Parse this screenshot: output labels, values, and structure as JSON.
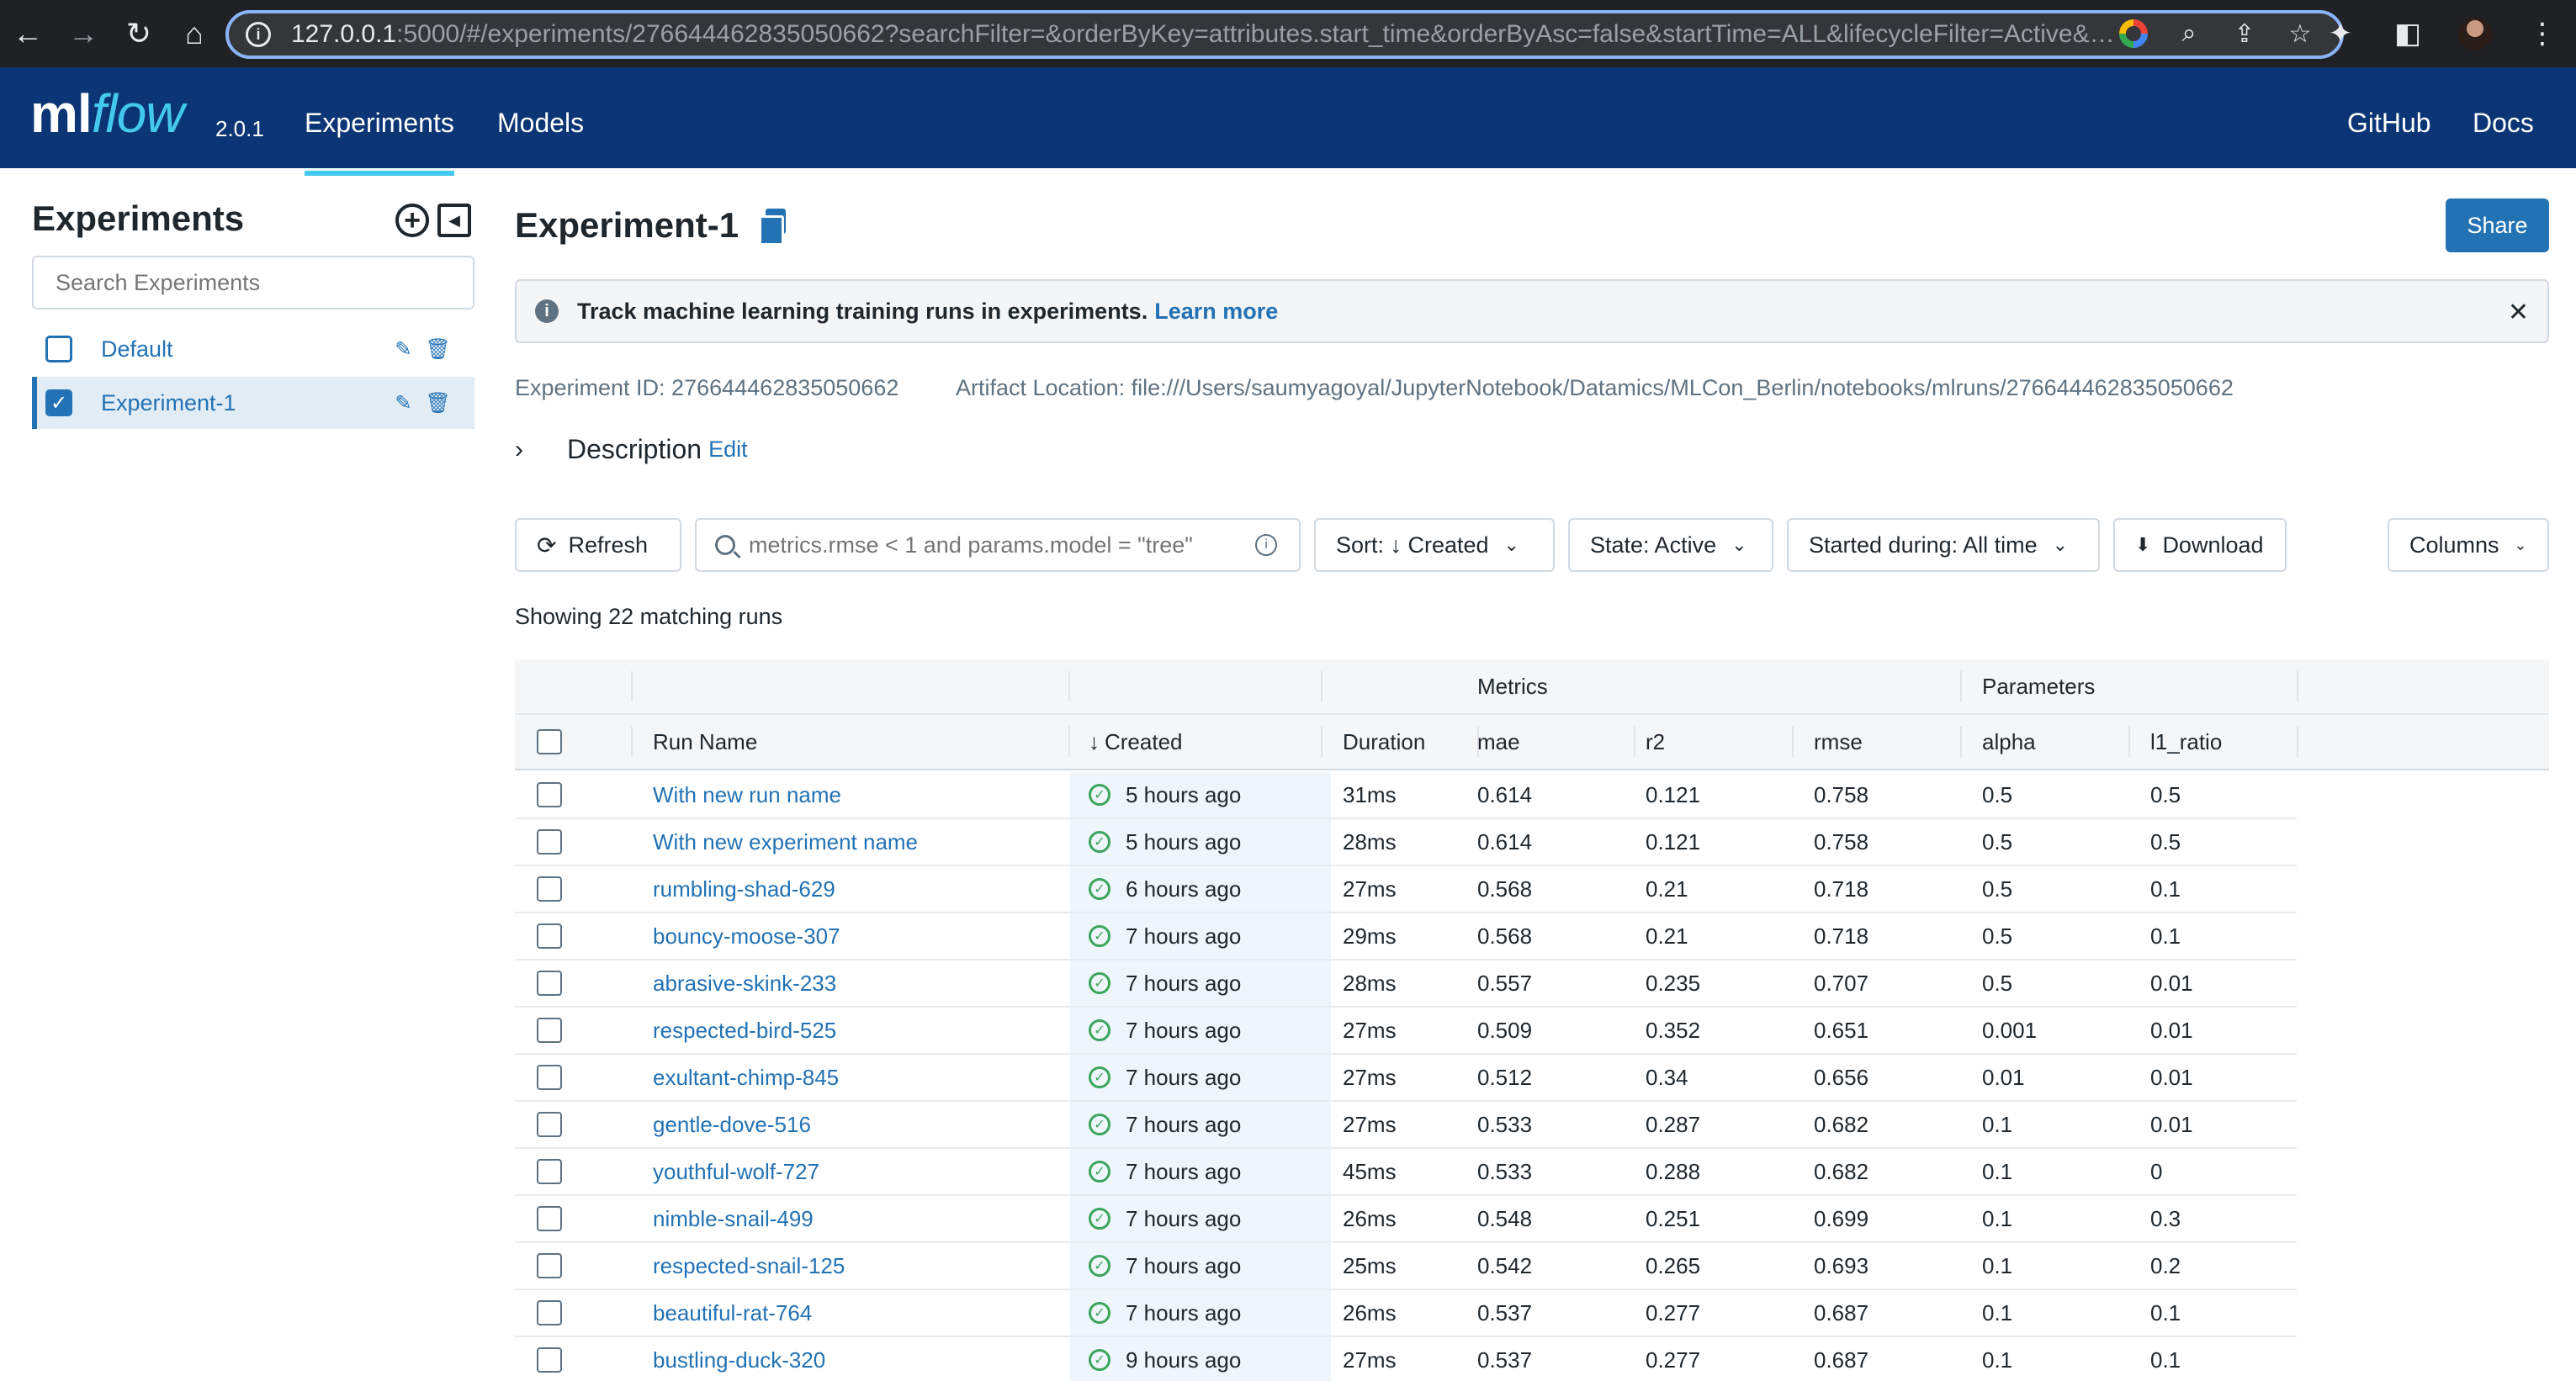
{
  "browser": {
    "url_host": "127.0.0.1",
    "url_rest": ":5000/#/experiments/276644462835050662?searchFilter=&orderByKey=attributes.start_time&orderByAsc=false&startTime=ALL&lifecycleFilter=Active&…"
  },
  "header": {
    "logo_ml": "ml",
    "logo_flow": "flow",
    "version": "2.0.1",
    "nav": [
      "Experiments",
      "Models"
    ],
    "right_links": [
      "GitHub",
      "Docs"
    ]
  },
  "sidebar": {
    "title": "Experiments",
    "search_placeholder": "Search Experiments",
    "items": [
      {
        "label": "Default",
        "checked": false
      },
      {
        "label": "Experiment-1",
        "checked": true
      }
    ]
  },
  "experiment": {
    "title": "Experiment-1",
    "share_label": "Share",
    "banner_text": "Track machine learning training runs in experiments.",
    "banner_link": "Learn more",
    "experiment_id": "Experiment ID: 276644462835050662",
    "artifact_location": "Artifact Location: file:///Users/saumyagoyal/JupyterNotebook/Datamics/MLCon_Berlin/notebooks/mlruns/276644462835050662",
    "description_label": "Description",
    "description_edit": "Edit"
  },
  "toolbar": {
    "refresh": "Refresh",
    "search_placeholder": "metrics.rmse < 1 and params.model = \"tree\"",
    "sort": "Sort: ↓ Created",
    "state": "State: Active",
    "started": "Started during: All time",
    "download": "Download",
    "columns": "Columns"
  },
  "match_count": "Showing 22 matching runs",
  "table": {
    "groups": {
      "metrics": "Metrics",
      "parameters": "Parameters"
    },
    "headers": [
      "Run Name",
      "Created",
      "Duration",
      "mae",
      "r2",
      "rmse",
      "alpha",
      "l1_ratio"
    ],
    "rows": [
      {
        "name": "With new run name",
        "created": "5 hours ago",
        "duration": "31ms",
        "mae": "0.614",
        "r2": "0.121",
        "rmse": "0.758",
        "alpha": "0.5",
        "l1_ratio": "0.5"
      },
      {
        "name": "With new experiment name",
        "created": "5 hours ago",
        "duration": "28ms",
        "mae": "0.614",
        "r2": "0.121",
        "rmse": "0.758",
        "alpha": "0.5",
        "l1_ratio": "0.5"
      },
      {
        "name": "rumbling-shad-629",
        "created": "6 hours ago",
        "duration": "27ms",
        "mae": "0.568",
        "r2": "0.21",
        "rmse": "0.718",
        "alpha": "0.5",
        "l1_ratio": "0.1"
      },
      {
        "name": "bouncy-moose-307",
        "created": "7 hours ago",
        "duration": "29ms",
        "mae": "0.568",
        "r2": "0.21",
        "rmse": "0.718",
        "alpha": "0.5",
        "l1_ratio": "0.1"
      },
      {
        "name": "abrasive-skink-233",
        "created": "7 hours ago",
        "duration": "28ms",
        "mae": "0.557",
        "r2": "0.235",
        "rmse": "0.707",
        "alpha": "0.5",
        "l1_ratio": "0.01"
      },
      {
        "name": "respected-bird-525",
        "created": "7 hours ago",
        "duration": "27ms",
        "mae": "0.509",
        "r2": "0.352",
        "rmse": "0.651",
        "alpha": "0.001",
        "l1_ratio": "0.01"
      },
      {
        "name": "exultant-chimp-845",
        "created": "7 hours ago",
        "duration": "27ms",
        "mae": "0.512",
        "r2": "0.34",
        "rmse": "0.656",
        "alpha": "0.01",
        "l1_ratio": "0.01"
      },
      {
        "name": "gentle-dove-516",
        "created": "7 hours ago",
        "duration": "27ms",
        "mae": "0.533",
        "r2": "0.287",
        "rmse": "0.682",
        "alpha": "0.1",
        "l1_ratio": "0.01"
      },
      {
        "name": "youthful-wolf-727",
        "created": "7 hours ago",
        "duration": "45ms",
        "mae": "0.533",
        "r2": "0.288",
        "rmse": "0.682",
        "alpha": "0.1",
        "l1_ratio": "0"
      },
      {
        "name": "nimble-snail-499",
        "created": "7 hours ago",
        "duration": "26ms",
        "mae": "0.548",
        "r2": "0.251",
        "rmse": "0.699",
        "alpha": "0.1",
        "l1_ratio": "0.3"
      },
      {
        "name": "respected-snail-125",
        "created": "7 hours ago",
        "duration": "25ms",
        "mae": "0.542",
        "r2": "0.265",
        "rmse": "0.693",
        "alpha": "0.1",
        "l1_ratio": "0.2"
      },
      {
        "name": "beautiful-rat-764",
        "created": "7 hours ago",
        "duration": "26ms",
        "mae": "0.537",
        "r2": "0.277",
        "rmse": "0.687",
        "alpha": "0.1",
        "l1_ratio": "0.1"
      },
      {
        "name": "bustling-duck-320",
        "created": "9 hours ago",
        "duration": "27ms",
        "mae": "0.537",
        "r2": "0.277",
        "rmse": "0.687",
        "alpha": "0.1",
        "l1_ratio": "0.1"
      }
    ]
  },
  "colors": {
    "header_bg": "#0b3574",
    "accent": "#2272b4",
    "logo_flow": "#43c9ed",
    "success": "#3ba55d"
  }
}
